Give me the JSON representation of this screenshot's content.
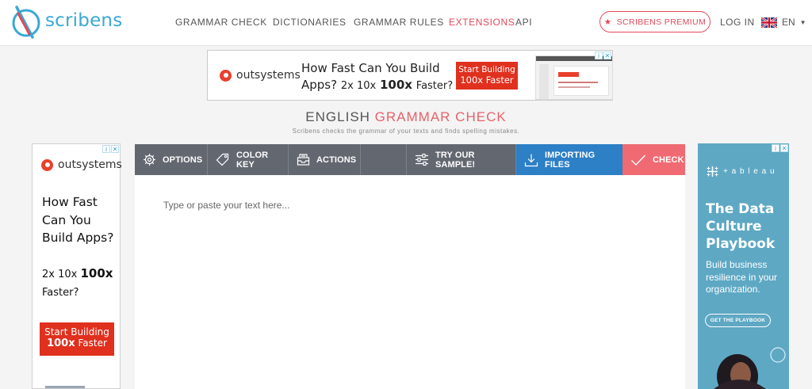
{
  "header": {
    "logo_text": "scribens",
    "nav": [
      "GRAMMAR CHECK",
      "DICTIONARIES",
      "GRAMMAR RULES",
      "EXTENSIONS",
      "API"
    ],
    "premium_label": "SCRIBENS PREMIUM",
    "login_label": "LOG IN",
    "language": "EN"
  },
  "ad_top": {
    "brand": "outsystems",
    "headline_1": "How Fast Can You Build",
    "headline_2a": "Apps?",
    "headline_2b": "2x 10x",
    "headline_2c": "100x",
    "headline_2d": "Faster?",
    "cta_1": "Start Building",
    "cta_2": "100x Faster"
  },
  "page": {
    "title_part1": "ENGLISH",
    "title_part2": "GRAMMAR CHECK",
    "subtitle": "Scribens checks the grammar of your texts and finds spelling mistakes."
  },
  "toolbar": {
    "options": "OPTIONS",
    "color_key": "COLOR KEY",
    "actions": "ACTIONS",
    "sample": "TRY OUR SAMPLE!",
    "importing": "IMPORTING FILES",
    "check": "CHECK"
  },
  "editor": {
    "placeholder": "Type or paste your text here..."
  },
  "ad_left": {
    "brand": "outsystems",
    "line1": "How Fast",
    "line2": "Can You",
    "line3": "Build Apps?",
    "line4a": "2x 10x",
    "line4b": "100x",
    "line5": "Faster?",
    "cta_1": "Start Building",
    "cta_2a": "100x",
    "cta_2b": "Faster"
  },
  "ad_right": {
    "brand": "+ a b l e a u",
    "h1": "The Data",
    "h2": "Culture",
    "h3": "Playbook",
    "b1": "Build business",
    "b2": "resilience in your",
    "b3": "organization.",
    "cta": "GET THE PLAYBOOK"
  },
  "colors": {
    "brand_blue": "#39a9d4",
    "accent_red": "#e0495a",
    "toolbar_gray": "#636770",
    "import_blue": "#2d7fc6",
    "check_red": "#ef6a72"
  }
}
